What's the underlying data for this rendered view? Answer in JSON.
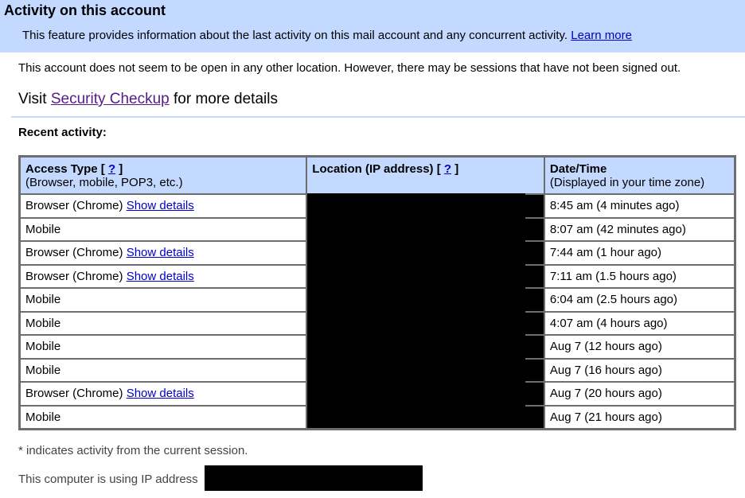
{
  "header": {
    "title": "Activity on this account",
    "description": "This feature provides information about the last activity on this mail account and any concurrent activity.",
    "learn_more": "Learn more"
  },
  "notice": "This account does not seem to be open in any other location. However, there may be sessions that have not been signed out.",
  "checkup": {
    "prefix": "Visit",
    "link": "Security Checkup",
    "suffix": "for more details"
  },
  "recent_label": "Recent activity:",
  "table": {
    "headers": {
      "access_type": "Access Type",
      "access_type_sub": "(Browser, mobile, POP3, etc.)",
      "location": "Location (IP address)",
      "datetime": "Date/Time",
      "datetime_sub": "(Displayed in your time zone)",
      "help_link": "?"
    },
    "show_details": "Show details",
    "rows": [
      {
        "access": "Browser (Chrome)",
        "details": true,
        "time": "8:45 am (4 minutes ago)"
      },
      {
        "access": "Mobile",
        "details": false,
        "time": "8:07 am (42 minutes ago)"
      },
      {
        "access": "Browser (Chrome)",
        "details": true,
        "time": "7:44 am (1 hour ago)"
      },
      {
        "access": "Browser (Chrome)",
        "details": true,
        "time": "7:11 am (1.5 hours ago)"
      },
      {
        "access": "Mobile",
        "details": false,
        "time": "6:04 am (2.5 hours ago)"
      },
      {
        "access": "Mobile",
        "details": false,
        "time": "4:07 am (4 hours ago)"
      },
      {
        "access": "Mobile",
        "details": false,
        "time": "Aug 7 (12 hours ago)"
      },
      {
        "access": "Mobile",
        "details": false,
        "time": "Aug 7 (16 hours ago)"
      },
      {
        "access": "Browser (Chrome)",
        "details": true,
        "time": "Aug 7 (20 hours ago)"
      },
      {
        "access": "Mobile",
        "details": false,
        "time": "Aug 7 (21 hours ago)"
      }
    ]
  },
  "footnote": "* indicates activity from the current session.",
  "ip_line": "This computer is using IP address",
  "colors": {
    "header_bg": "#c3d9ff",
    "link": "#0000cc",
    "visited_link": "#551a8b",
    "redaction": "#000000"
  }
}
